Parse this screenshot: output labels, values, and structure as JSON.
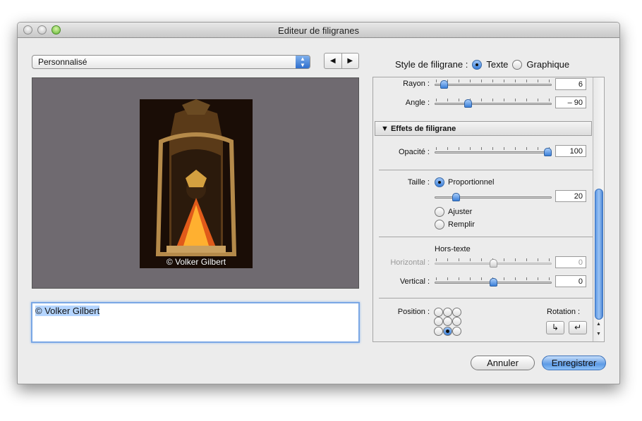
{
  "window": {
    "title": "Editeur de filigranes"
  },
  "preset": {
    "selected": "Personnalisé"
  },
  "preview": {
    "watermark_text": "© Volker Gilbert"
  },
  "text_input": {
    "value": "© Volker Gilbert"
  },
  "style": {
    "label": "Style de filigrane :",
    "option_text": "Texte",
    "option_graphic": "Graphique",
    "selected": "Texte"
  },
  "panel": {
    "rayon": {
      "label": "Rayon :",
      "value": "6",
      "level": 0.05
    },
    "angle": {
      "label": "Angle :",
      "value": "– 90",
      "level": 0.27
    },
    "effects_header": "Effets de filigrane",
    "opacity": {
      "label": "Opacité :",
      "value": "100",
      "level": 1.0
    },
    "size": {
      "label": "Taille :",
      "opt_proportional": "Proportionnel",
      "opt_fit": "Ajuster",
      "opt_fill": "Remplir",
      "selected": "Proportionnel",
      "value": "20",
      "level": 0.16
    },
    "inset": {
      "title": "Hors-texte",
      "horizontal_label": "Horizontal :",
      "horizontal_value": "0",
      "horizontal_level": 0.5,
      "vertical_label": "Vertical :",
      "vertical_value": "0",
      "vertical_level": 0.5
    },
    "position": {
      "label": "Position :",
      "selected_cell": "bottom-center"
    },
    "rotation": {
      "label": "Rotation :"
    }
  },
  "buttons": {
    "cancel": "Annuler",
    "save": "Enregistrer"
  },
  "icons": {
    "nav_prev": "◀",
    "nav_next": "▶",
    "popup_arrows": "▲▼",
    "rotate_cw": "↳",
    "rotate_ccw": "↵"
  }
}
